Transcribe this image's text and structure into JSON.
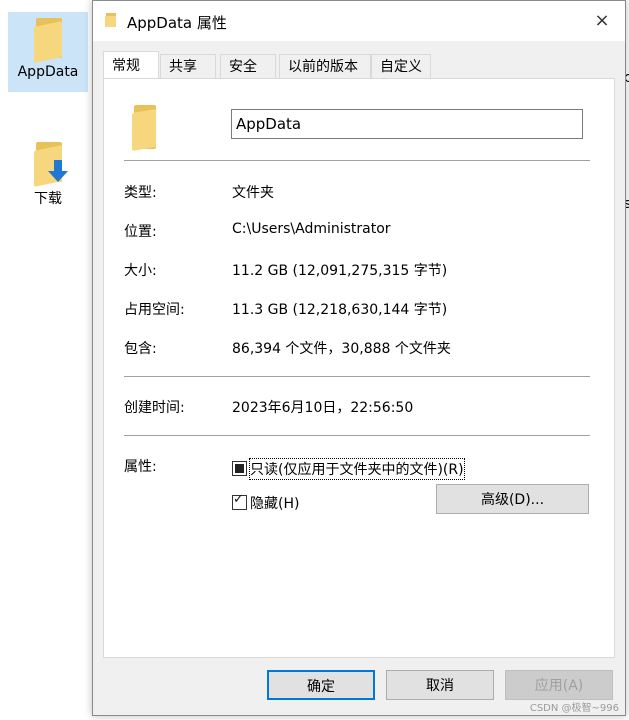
{
  "desktop": {
    "items": [
      {
        "label": "AppData",
        "icon": "folder-icon"
      },
      {
        "label": "下载",
        "icon": "download-folder-icon"
      }
    ],
    "fragment_right": "ice",
    "fragment_right2": "is"
  },
  "window": {
    "title": "AppData 属性",
    "close_icon": "×"
  },
  "tabs": [
    "常规",
    "共享",
    "安全",
    "以前的版本",
    "自定义"
  ],
  "general": {
    "name_value": "AppData",
    "rows": [
      {
        "label": "类型:",
        "value": "文件夹"
      },
      {
        "label": "位置:",
        "value": "C:\\Users\\Administrator"
      },
      {
        "label": "大小:",
        "value": "11.2 GB (12,091,275,315 字节)"
      },
      {
        "label": "占用空间:",
        "value": "11.3 GB (12,218,630,144 字节)"
      },
      {
        "label": "包含:",
        "value": "86,394 个文件，30,888 个文件夹"
      }
    ],
    "created_label": "创建时间:",
    "created_value": "2023年6月10日，22:56:50",
    "attributes_label": "属性:",
    "readonly_label": "只读(仅应用于文件夹中的文件)(R)",
    "hidden_label": "隐藏(H)",
    "advanced_label": "高级(D)..."
  },
  "buttons": {
    "ok": "确定",
    "cancel": "取消",
    "apply": "应用(A)"
  },
  "watermark": "CSDN @极智~996"
}
